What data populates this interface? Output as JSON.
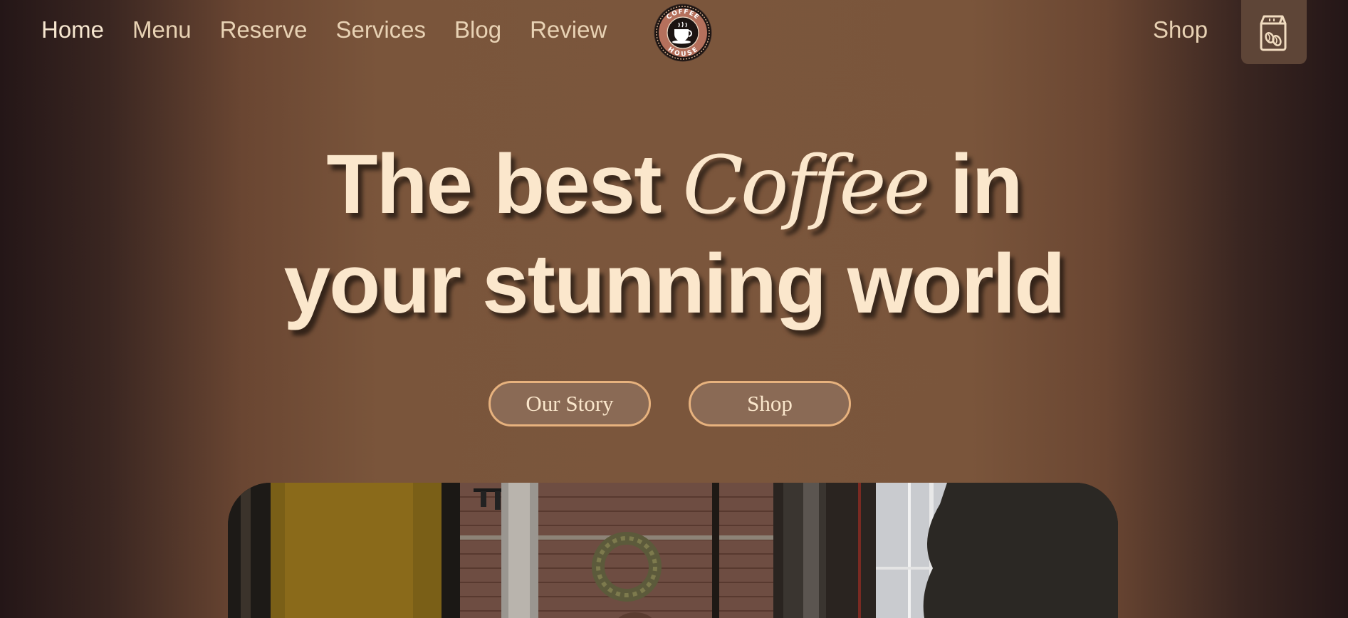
{
  "nav": {
    "links": [
      "Home",
      "Menu",
      "Reserve",
      "Services",
      "Blog",
      "Review"
    ],
    "shop_label": "Shop",
    "logo": {
      "top_text": "COFFEE",
      "bottom_text": "HOUSE",
      "icon": "coffee-cup-icon"
    },
    "cart_icon": "coffee-bag-icon"
  },
  "hero": {
    "title_part1": "The best ",
    "title_script": "Coffee",
    "title_part2": " in",
    "title_line2": "your stunning world",
    "buttons": {
      "our_story": "Our Story",
      "shop": "Shop"
    }
  },
  "colors": {
    "text_cream": "#fbe7cc",
    "button_border": "#e7b27e",
    "button_fill": "#8a6a55",
    "bg_center": "#7b563c",
    "bg_edge": "#241617"
  }
}
